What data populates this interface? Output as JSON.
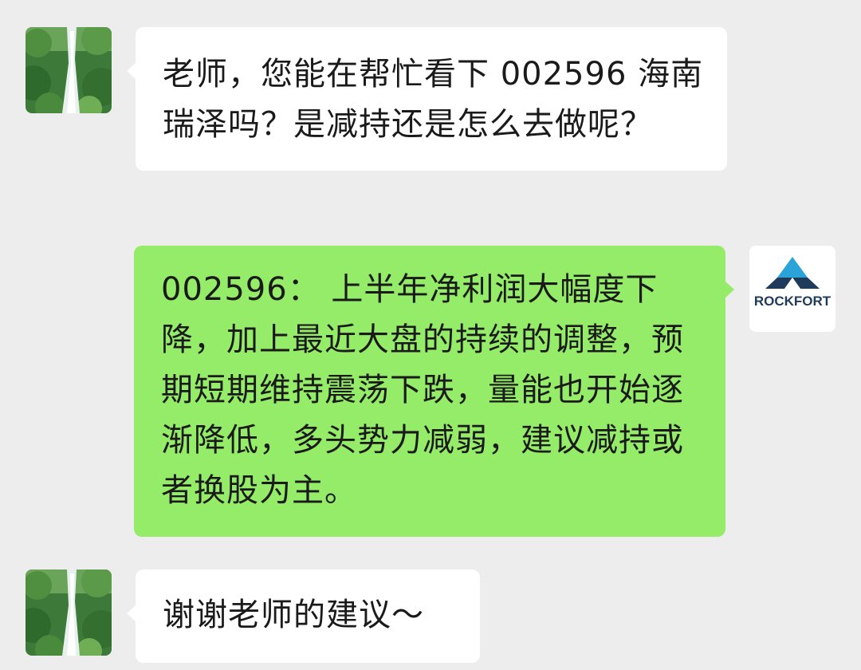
{
  "chat": {
    "messages": [
      {
        "sender": "user",
        "avatar_icon": "waterfall-photo-icon",
        "text": "老师，您能在帮忙看下 002596 海南瑞泽吗？是减持还是怎么去做呢？"
      },
      {
        "sender": "advisor",
        "avatar_icon": "rockfort-logo-icon",
        "avatar_logo_text": "ROCKFORT",
        "text": "002596： 上半年净利润大幅度下降，加上最近大盘的持续的调整，预期短期维持震荡下跌，量能也开始逐渐降低，多头势力减弱，建议减持或者换股为主。"
      },
      {
        "sender": "user",
        "avatar_icon": "waterfall-photo-icon",
        "text": "谢谢老师的建议～"
      }
    ]
  },
  "colors": {
    "background": "#ededed",
    "incoming_bubble": "#ffffff",
    "outgoing_bubble": "#95ec69",
    "logo_dark": "#1f3b5c",
    "logo_accent": "#2aa3d8"
  }
}
